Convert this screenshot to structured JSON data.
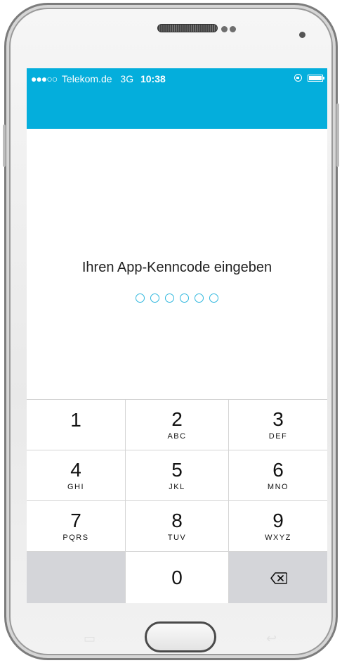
{
  "status_bar": {
    "signal": "●●●○○",
    "carrier": "Telekom.de",
    "network": "3G",
    "time": "10:38"
  },
  "passcode": {
    "prompt": "Ihren App-Kenncode eingeben",
    "digits_total": 6,
    "digits_entered": 0
  },
  "keypad": {
    "keys": [
      {
        "num": "1",
        "letters": ""
      },
      {
        "num": "2",
        "letters": "ABC"
      },
      {
        "num": "3",
        "letters": "DEF"
      },
      {
        "num": "4",
        "letters": "GHI"
      },
      {
        "num": "5",
        "letters": "JKL"
      },
      {
        "num": "6",
        "letters": "MNO"
      },
      {
        "num": "7",
        "letters": "PQRS"
      },
      {
        "num": "8",
        "letters": "TUV"
      },
      {
        "num": "9",
        "letters": "WXYZ"
      },
      {
        "num": "0",
        "letters": ""
      }
    ]
  },
  "colors": {
    "accent": "#04aedc",
    "keypad_gray": "#d4d5d9"
  },
  "icons": {
    "rotation_lock": "rotation-lock-icon",
    "battery": "battery-icon",
    "delete": "backspace-icon"
  }
}
